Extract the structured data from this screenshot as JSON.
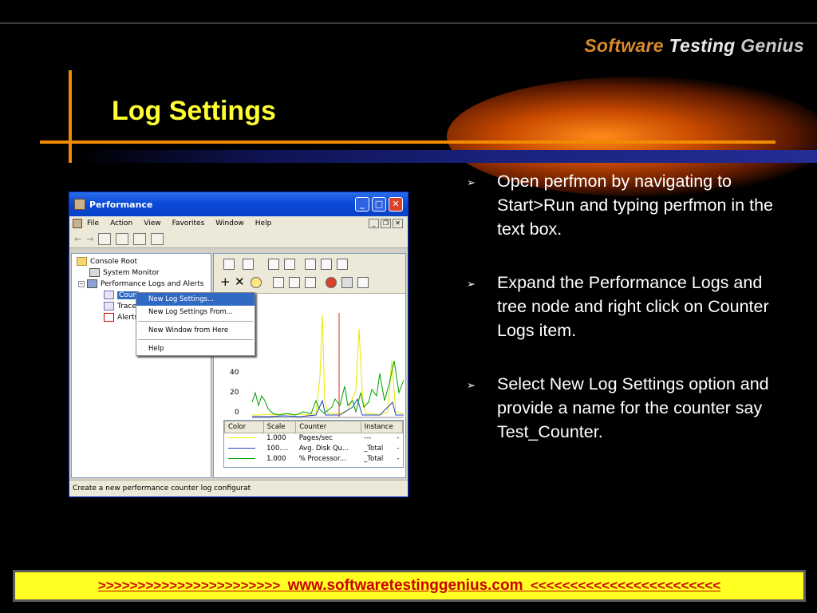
{
  "logo": {
    "part1": "Software",
    "part2": "Testing",
    "part3": "Genius"
  },
  "slide": {
    "title": "Log Settings"
  },
  "bullets": [
    "Open perfmon by navigating to Start>Run and typing perfmon in the text box.",
    "Expand the Performance Logs and tree node and right click on Counter Logs item.",
    "Select New Log Settings option and provide a name for the counter say Test_Counter."
  ],
  "footer": {
    "left_arrows": ">>>>>>>>>>>>>>>>>>>>>>>",
    "url": "www.softwaretestinggenius.com",
    "right_arrows": "<<<<<<<<<<<<<<<<<<<<<<<<"
  },
  "window": {
    "title": "Performance",
    "controls": {
      "minimize": "_",
      "maximize": "□",
      "close": "✕"
    },
    "menu": [
      "File",
      "Action",
      "View",
      "Favorites",
      "Window",
      "Help"
    ],
    "mdi_controls": [
      "_",
      "❐",
      "✕"
    ],
    "toolbar_arrows": {
      "back": "←",
      "forward": "→"
    },
    "tree": {
      "console_root": "Console Root",
      "system_monitor": "System Monitor",
      "perf_logs": "Performance Logs and Alerts",
      "counter_logs": "Coun",
      "trace_logs": "Trace",
      "alerts": "Alerts",
      "expander_minus": "−"
    },
    "right_toolbar_glyphs": {
      "add": "+",
      "delete": "✕"
    },
    "y_ticks": [
      "40",
      "20",
      "0"
    ],
    "legend": {
      "headers": [
        "Color",
        "Scale",
        "Counter",
        "Instance"
      ],
      "rows": [
        {
          "color": "#f0f000",
          "scale": "1.000",
          "counter": "Pages/sec",
          "instance": "---",
          "extra": "-"
        },
        {
          "color": "#2040c0",
          "scale": "100....",
          "counter": "Avg. Disk Qu...",
          "instance": "_Total",
          "extra": "-"
        },
        {
          "color": "#00a000",
          "scale": "1.000",
          "counter": "% Processor...",
          "instance": "_Total",
          "extra": "-"
        }
      ]
    },
    "status": "Create a new performance counter log configurat"
  },
  "context_menu": {
    "items": [
      "New Log Settings...",
      "New Log Settings From...",
      "New Window from Here",
      "Help"
    ]
  }
}
